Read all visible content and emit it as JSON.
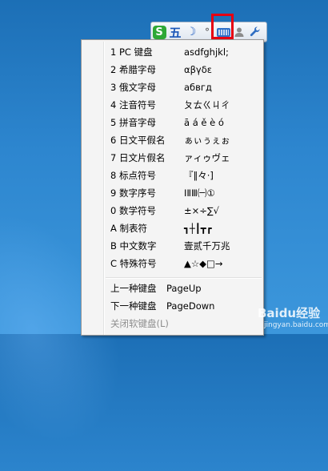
{
  "toolbar": {
    "logo_letter": "S",
    "wu": "五",
    "moon": "☽",
    "dot": "°",
    "person": "●",
    "wrench": "🔧",
    "icons": [
      "sogou-logo-icon",
      "wubi-mode-icon",
      "moon-icon",
      "punctuation-icon",
      "soft-keyboard-icon",
      "user-icon",
      "wrench-icon"
    ]
  },
  "menu": {
    "items": [
      {
        "label": "1 PC 键盘",
        "preview": "asdfghjkl;"
      },
      {
        "label": "2 希腊字母",
        "preview": "αβγδε"
      },
      {
        "label": "3 俄文字母",
        "preview": "абвгд"
      },
      {
        "label": "4 注音符号",
        "preview": "ㄆㄊㄍㄐㄔ"
      },
      {
        "label": "5 拼音字母",
        "preview": "ā á ě è ó"
      },
      {
        "label": "6 日文平假名",
        "preview": "ぁぃぅぇぉ"
      },
      {
        "label": "7 日文片假名",
        "preview": "ァィゥヴェ"
      },
      {
        "label": "8 标点符号",
        "preview": "『‖々·]"
      },
      {
        "label": "9 数字序号",
        "preview": "ⅠⅡⅢ㈠①"
      },
      {
        "label": "0 数学符号",
        "preview": "±×÷∑√"
      },
      {
        "label": "A 制表符",
        "preview": "┓┼┃┳┏"
      },
      {
        "label": "B 中文数字",
        "preview": "壹贰千万兆"
      },
      {
        "label": "C 特殊符号",
        "preview": "▲☆◆□→"
      }
    ],
    "nav": [
      {
        "label": "上一种键盘",
        "preview": "PageUp"
      },
      {
        "label": "下一种键盘",
        "preview": "PageDown"
      }
    ],
    "close_label": "关闭软键盘(L)"
  },
  "watermark": {
    "text": "Baidu经验",
    "sub": "jingyan.baidu.com"
  },
  "colors": {
    "highlight": "#e60012",
    "desktop": "#2d86cf"
  }
}
